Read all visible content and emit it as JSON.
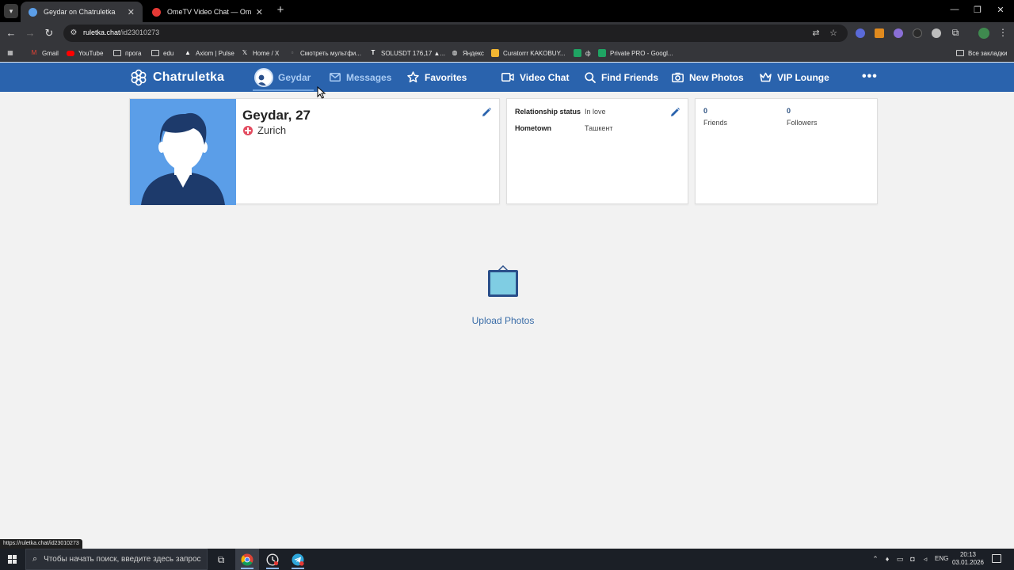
{
  "browser": {
    "tabs": [
      {
        "title": "Geydar on Chatruletka",
        "active": true,
        "favicon_color": "#5b9ee8"
      },
      {
        "title": "OmeTV Video Chat — Omegle",
        "active": false,
        "favicon_color": "#e53935"
      }
    ],
    "new_tab": "+",
    "window_controls": {
      "minimize": "—",
      "maximize": "❐",
      "close": "✕"
    },
    "address": {
      "host": "ruletka.chat",
      "path": "/id23010273"
    },
    "bookmarks": [
      {
        "label": "Gmail",
        "icon": "gmail-icon",
        "color": "#ea4335"
      },
      {
        "label": "YouTube",
        "icon": "youtube-icon",
        "color": "#ff0000"
      },
      {
        "label": "прога",
        "icon": "folder-icon"
      },
      {
        "label": "edu",
        "icon": "folder-icon"
      },
      {
        "label": "Axiom | Pulse",
        "icon": "axiom-icon",
        "color": "#ffffff"
      },
      {
        "label": "Home / X",
        "icon": "x-icon",
        "color": "#ffffff"
      },
      {
        "label": "Смотреть мультфи...",
        "icon": "play-icon",
        "color": "#888888"
      },
      {
        "label": "SOLUSDT 176,17 ▲...",
        "icon": "tradingview-icon",
        "color": "#ffffff"
      },
      {
        "label": "Яндекс",
        "icon": "globe-icon",
        "color": "#ffffff"
      },
      {
        "label": "Curatorrr KAKOBUY...",
        "icon": "kakobuy-icon",
        "color": "#f2b632"
      },
      {
        "label": "ф",
        "icon": "sheets-icon",
        "color": "#1fa463"
      },
      {
        "label": "Private PRO - Googl...",
        "icon": "sheets-icon",
        "color": "#1fa463"
      }
    ],
    "all_bookmarks": "Все закладки",
    "status_url": "https://ruletka.chat/id23010273"
  },
  "site": {
    "brand": "Chatruletka",
    "accent": "#2a63ad",
    "nav": [
      {
        "label": "Geydar",
        "icon": "avatar-icon",
        "active": true
      },
      {
        "label": "Messages",
        "icon": "envelope-icon",
        "active": false
      },
      {
        "label": "Favorites",
        "icon": "star-icon",
        "active": false
      },
      {
        "label": "Video Chat",
        "icon": "video-camera-icon",
        "active": false
      },
      {
        "label": "Find Friends",
        "icon": "search-icon",
        "active": false
      },
      {
        "label": "New Photos",
        "icon": "camera-icon",
        "active": false
      },
      {
        "label": "VIP Lounge",
        "icon": "crown-icon",
        "active": false
      }
    ],
    "more": "•••"
  },
  "profile": {
    "name_age": "Geydar, 27",
    "location": "Zurich",
    "relationship_label": "Relationship status",
    "relationship_value": "In love",
    "hometown_label": "Hometown",
    "hometown_value": "Ташкент",
    "friends_count": "0",
    "friends_label": "Friends",
    "followers_count": "0",
    "followers_label": "Followers",
    "upload_label": "Upload Photos"
  },
  "taskbar": {
    "search_placeholder": "Чтобы начать поиск, введите здесь запрос",
    "language": "ENG",
    "time": "20:13",
    "date": "03.01.2026"
  }
}
